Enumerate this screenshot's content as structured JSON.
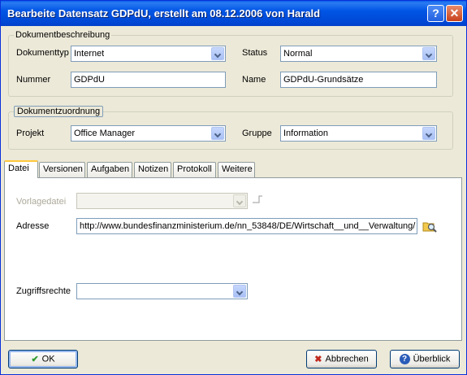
{
  "window": {
    "title": "Bearbeite Datensatz GDPdU, erstellt am 08.12.2006 von Harald",
    "help_icon": "?",
    "close_icon": "✕"
  },
  "beschreibung": {
    "legend": "Dokumentbeschreibung",
    "dokumenttyp_label": "Dokumenttyp",
    "dokumenttyp_value": "Internet",
    "status_label": "Status",
    "status_value": "Normal",
    "nummer_label": "Nummer",
    "nummer_value": "GDPdU",
    "name_label": "Name",
    "name_value": "GDPdU-Grundsätze"
  },
  "zuordnung": {
    "legend": "Dokumentzuordnung",
    "projekt_label": "Projekt",
    "projekt_value": "Office Manager",
    "gruppe_label": "Gruppe",
    "gruppe_value": "Information"
  },
  "tabs": [
    {
      "label": "Datei"
    },
    {
      "label": "Versionen"
    },
    {
      "label": "Aufgaben"
    },
    {
      "label": "Notizen"
    },
    {
      "label": "Protokoll"
    },
    {
      "label": "Weitere"
    }
  ],
  "datei": {
    "vorlagedatei_label": "Vorlagedatei",
    "vorlagedatei_value": "",
    "adresse_label": "Adresse",
    "adresse_value": "http://www.bundesfinanzministerium.de/nn_53848/DE/Wirtschaft__und__Verwaltung/",
    "zugriffsrechte_label": "Zugriffsrechte",
    "zugriffsrechte_value": ""
  },
  "buttons": {
    "ok": "OK",
    "abbrechen": "Abbrechen",
    "ueberblick": "Überblick"
  },
  "icons": {
    "ok_icon": "✔",
    "abbrechen_icon": "✖",
    "ueberblick_icon": "?",
    "browse_icon": "folder-search-icon"
  },
  "colors": {
    "titlebar": "#0055E5",
    "dialog_bg": "#ECE9D8",
    "tab_highlight": "#FFC83C",
    "ok_check": "#2E9B2E",
    "cancel_x": "#C0281C"
  }
}
